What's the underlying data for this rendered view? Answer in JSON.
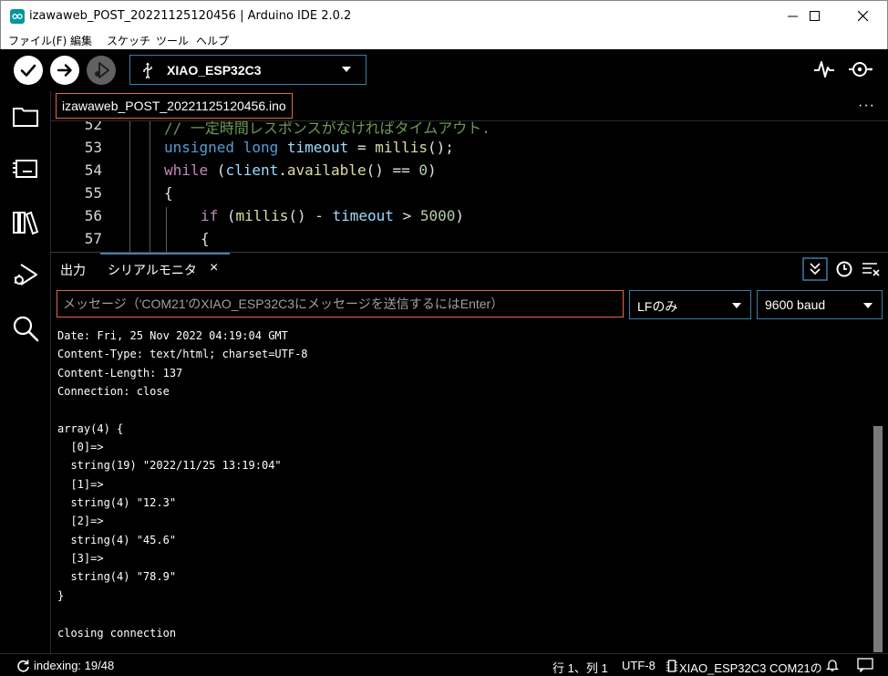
{
  "window": {
    "title": "izawaweb_POST_20221125120456 | Arduino IDE 2.0.2"
  },
  "menu": {
    "file": "ファイル(F)",
    "edit": "編集",
    "sketch": "スケッチ",
    "tools": "ツール",
    "help": "ヘルプ"
  },
  "toolbar": {
    "board": "XIAO_ESP32C3"
  },
  "editor": {
    "tab": "izawaweb_POST_20221125120456.ino",
    "more": "···",
    "lines": [
      {
        "num": "52",
        "code": "// 一定時間レスポンスがなければタイムアウト."
      },
      {
        "num": "53",
        "code": "unsigned long timeout = millis();"
      },
      {
        "num": "54",
        "code": "while (client.available() == 0)"
      },
      {
        "num": "55",
        "code": "{"
      },
      {
        "num": "56",
        "code": "if (millis() - timeout > 5000)"
      },
      {
        "num": "57",
        "code": "{"
      }
    ]
  },
  "panel": {
    "tab_output": "出力",
    "tab_serial": "シリアルモニタ",
    "tab_close": "×",
    "input_placeholder": "メッセージ（'COM21'のXIAO_ESP32C3にメッセージを送信するにはEnter）",
    "line_ending": "LFのみ",
    "baud": "9600 baud",
    "serial_lines": [
      "Date: Fri, 25 Nov 2022 04:19:04 GMT",
      "Content-Type: text/html; charset=UTF-8",
      "Content-Length: 137",
      "Connection: close",
      "",
      "array(4) {",
      "  [0]=>",
      "  string(19) \"2022/11/25 13:19:04\"",
      "  [1]=>",
      "  string(4) \"12.3\"",
      "  [2]=>",
      "  string(4) \"45.6\"",
      "  [3]=>",
      "  string(4) \"78.9\"",
      "}",
      "",
      "closing connection"
    ]
  },
  "status": {
    "indexing": "indexing: 19/48",
    "position": "行 1、列 1",
    "encoding": "UTF-8",
    "board_port": "XIAO_ESP32C3 COM21の"
  }
}
